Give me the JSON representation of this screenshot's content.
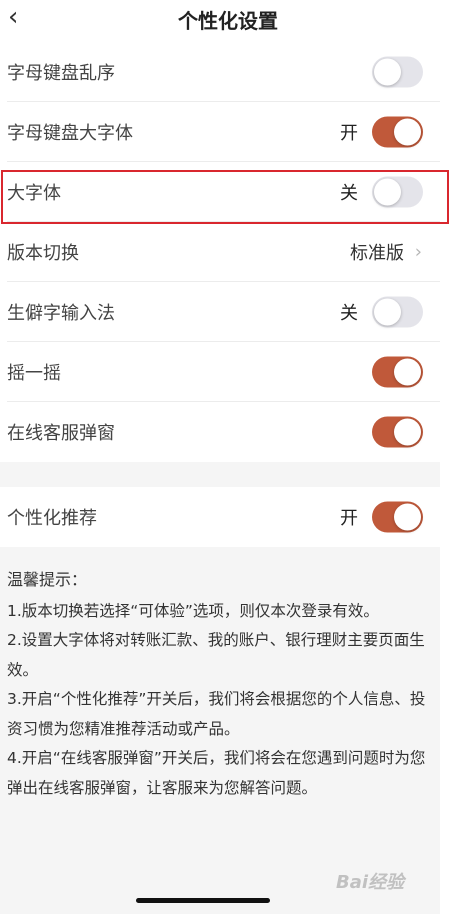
{
  "header": {
    "back_icon": "‹",
    "title": "个性化设置"
  },
  "rows": [
    {
      "label": "字母键盘乱序",
      "state_text": "",
      "toggle": "off"
    },
    {
      "label": "字母键盘大字体",
      "state_text": "开",
      "toggle": "on"
    },
    {
      "label": "大字体",
      "state_text": "关",
      "toggle": "off",
      "highlighted": true
    },
    {
      "label": "版本切换",
      "value": "标准版",
      "chevron": "›"
    },
    {
      "label": "生僻字输入法",
      "state_text": "关",
      "toggle": "off"
    },
    {
      "label": "摇一摇",
      "state_text": "",
      "toggle": "on"
    },
    {
      "label": "在线客服弹窗",
      "state_text": "",
      "toggle": "on"
    }
  ],
  "recommend_row": {
    "label": "个性化推荐",
    "state_text": "开",
    "toggle": "on"
  },
  "tips": {
    "title": "温馨提示：",
    "items": [
      "1.版本切换若选择“可体验”选项，则仅本次登录有效。",
      "2.设置大字体将对转账汇款、我的账户、银行理财主要页面生效。",
      "3.开启“个性化推荐”开关后，我们将会根据您的个人信息、投资习惯为您精准推荐活动或产品。",
      "4.开启“在线客服弹窗”开关后，我们将会在您遇到问题时为您弹出在线客服弹窗，让客服来为您解答问题。"
    ]
  },
  "watermark": "Bai经验",
  "colors": {
    "toggle_on": "#c0593a",
    "toggle_off": "#e4e4ea",
    "highlight_border": "#d9272e"
  }
}
